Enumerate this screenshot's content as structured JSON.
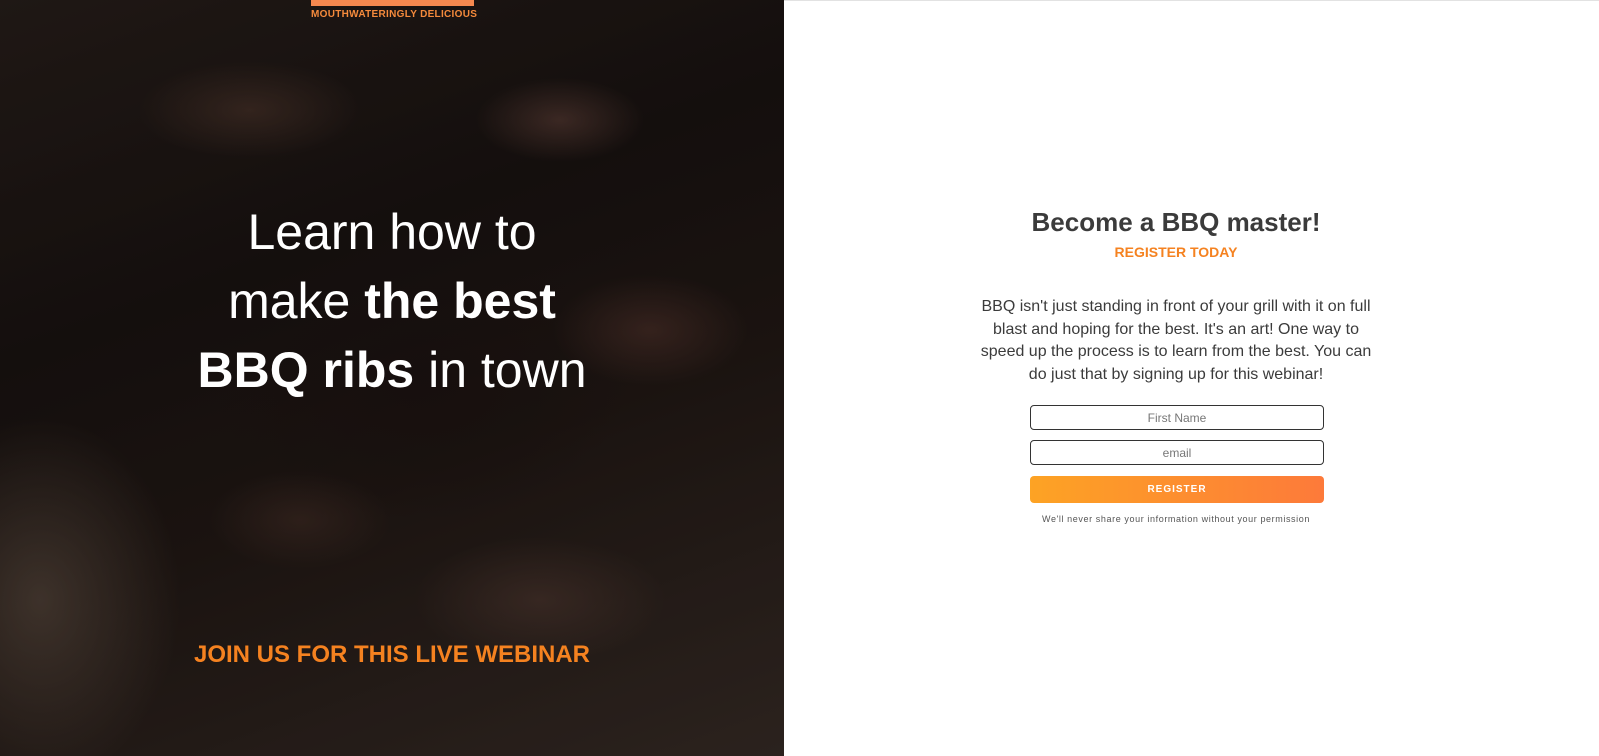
{
  "hero": {
    "tagline": "MOUTHWATERINGLY DELICIOUS",
    "headline_part1": "Learn how to make ",
    "headline_bold1": "the best BBQ ribs",
    "headline_part2": " in town",
    "join_text": "JOIN US FOR THIS LIVE WEBINAR",
    "accent_color": "#f58220"
  },
  "form": {
    "title": "Become a BBQ master!",
    "subtitle": "REGISTER TODAY",
    "description": "BBQ isn't just standing in front of your grill with it on full blast and hoping for the best. It's an art! One way to speed up the process is to learn from the best. You can do just that by signing up for this webinar!",
    "first_name_placeholder": "First Name",
    "email_placeholder": "email",
    "first_name_value": "",
    "email_value": "",
    "register_label": "REGISTER",
    "privacy_note": "We'll never share your information without your permission",
    "button_gradient": [
      "#fda324",
      "#fd7a3a"
    ]
  }
}
